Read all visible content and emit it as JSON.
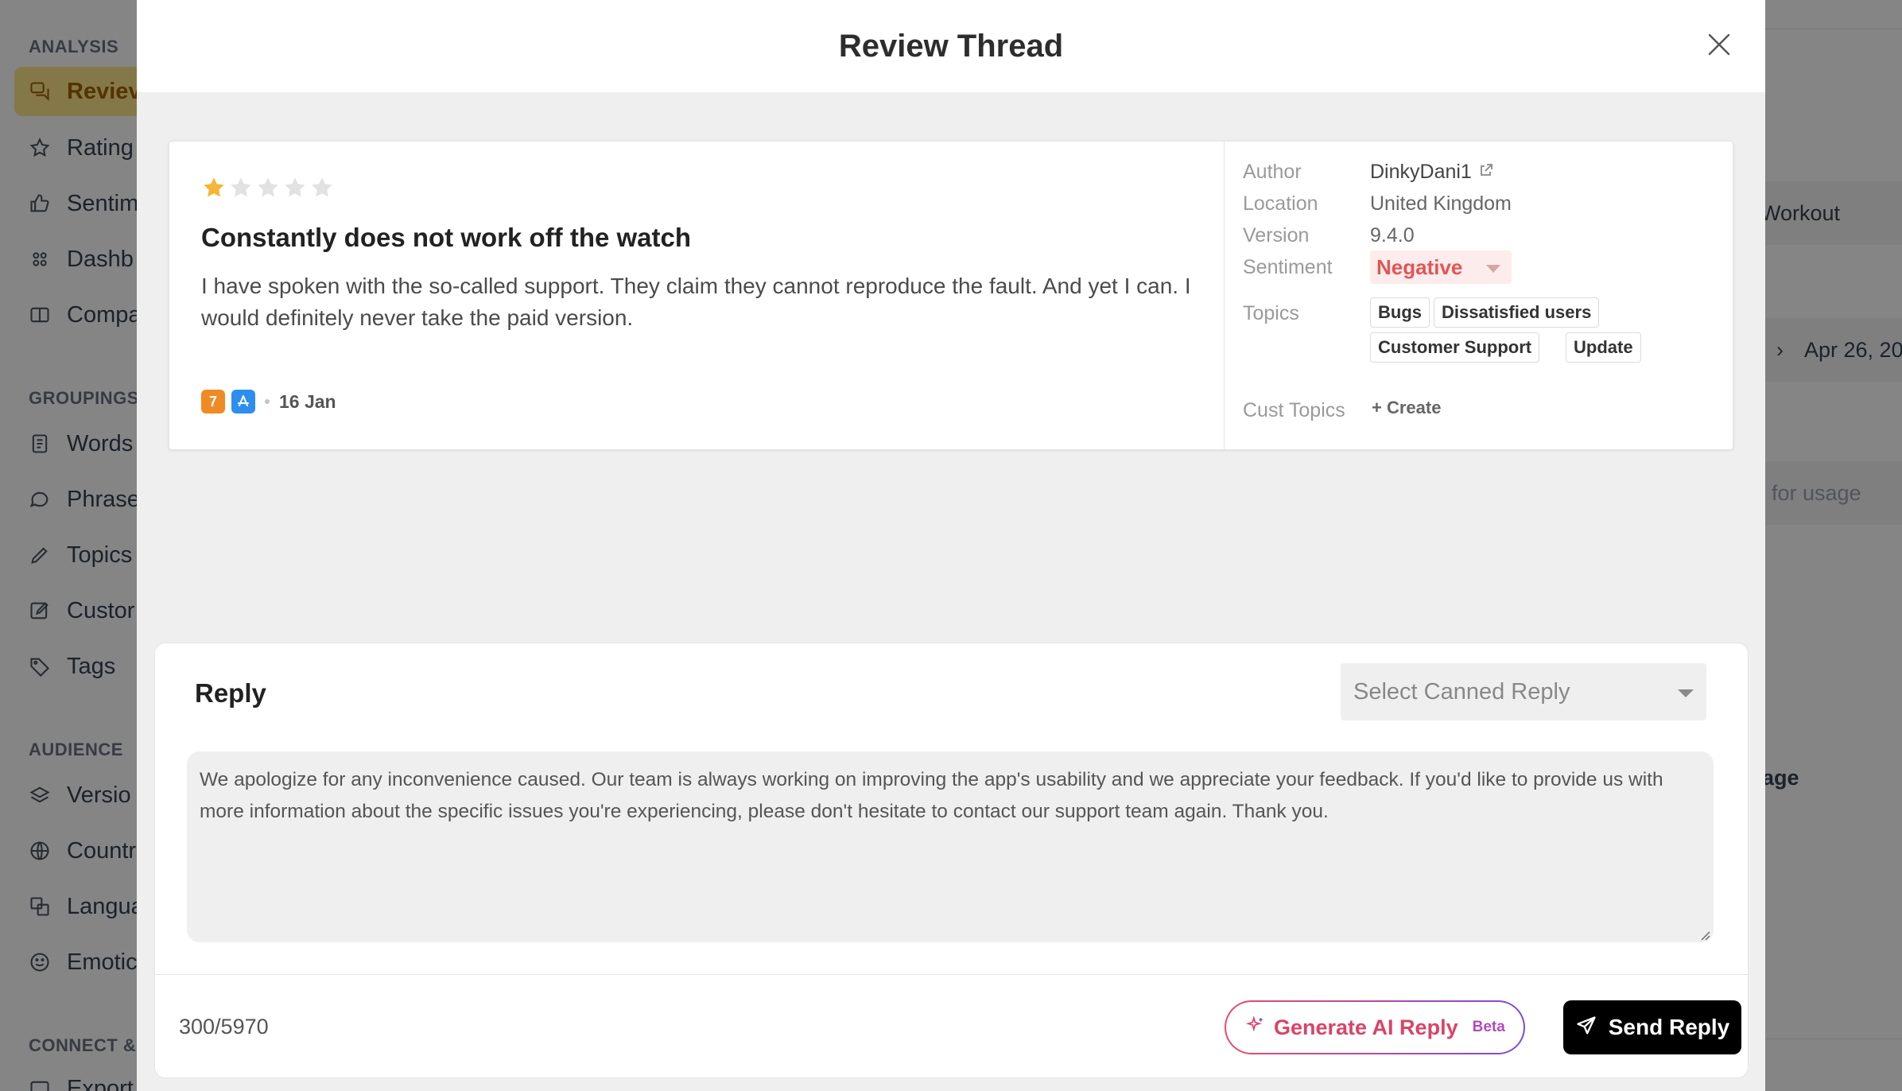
{
  "sidebar": {
    "sections": [
      {
        "label": "ANALYSIS"
      },
      {
        "label": "GROUPINGS"
      },
      {
        "label": "AUDIENCE"
      },
      {
        "label": "CONNECT &"
      }
    ],
    "items": [
      {
        "label": "Reviev",
        "icon": "reviews-icon"
      },
      {
        "label": "Rating",
        "icon": "star-icon"
      },
      {
        "label": "Sentim",
        "icon": "thumbs-up-icon"
      },
      {
        "label": "Dashb",
        "icon": "grid-icon"
      },
      {
        "label": "Compa",
        "icon": "columns-icon"
      },
      {
        "label": "Words",
        "icon": "document-icon"
      },
      {
        "label": "Phrase",
        "icon": "chat-icon"
      },
      {
        "label": "Topics",
        "icon": "pencil-icon"
      },
      {
        "label": "Custor",
        "icon": "edit-icon"
      },
      {
        "label": "Tags",
        "icon": "tag-icon"
      },
      {
        "label": "Versio",
        "icon": "layers-icon"
      },
      {
        "label": "Countr",
        "icon": "globe-icon"
      },
      {
        "label": "Langua",
        "icon": "translate-icon"
      },
      {
        "label": "Emotic",
        "icon": "smile-icon"
      },
      {
        "label": "Export",
        "icon": "export-icon"
      }
    ]
  },
  "background": {
    "workout": "Workout",
    "date": "Apr 26, 20",
    "usage": "for usage",
    "page": "age"
  },
  "modal": {
    "title": "Review Thread"
  },
  "review": {
    "rating": 1,
    "max_rating": 5,
    "title": "Constantly does not work off the watch",
    "body": "I have spoken with the so-called support. They claim they cannot reproduce the fault. And yet I can. I would definitely never take the paid version.",
    "app_badge": "7",
    "date": "16 Jan",
    "meta": {
      "author_label": "Author",
      "author": "DinkyDani1",
      "location_label": "Location",
      "location": "United Kingdom",
      "version_label": "Version",
      "version": "9.4.0",
      "sentiment_label": "Sentiment",
      "sentiment": "Negative",
      "topics_label": "Topics",
      "topics": [
        "Bugs",
        "Dissatisfied users",
        "Customer Support",
        "Update"
      ],
      "cust_topics_label": "Cust Topics",
      "create_label": "+ Create"
    }
  },
  "reply": {
    "title": "Reply",
    "canned_placeholder": "Select Canned Reply",
    "text": "We apologize for any inconvenience caused. Our team is always working on improving the app's usability and we appreciate your feedback. If you'd like to provide us with more information about the specific issues you're experiencing, please don't hesitate to contact our support team again. Thank you.",
    "char_count": "300/5970",
    "ai_button": "Generate AI Reply",
    "beta": "Beta",
    "send_button": "Send Reply"
  },
  "colors": {
    "star_filled": "#f5b536",
    "star_empty": "#e2e2e2",
    "negative": "#e15656",
    "accent_gradient_start": "#ea4b6a",
    "accent_gradient_end": "#7d4bd9"
  }
}
